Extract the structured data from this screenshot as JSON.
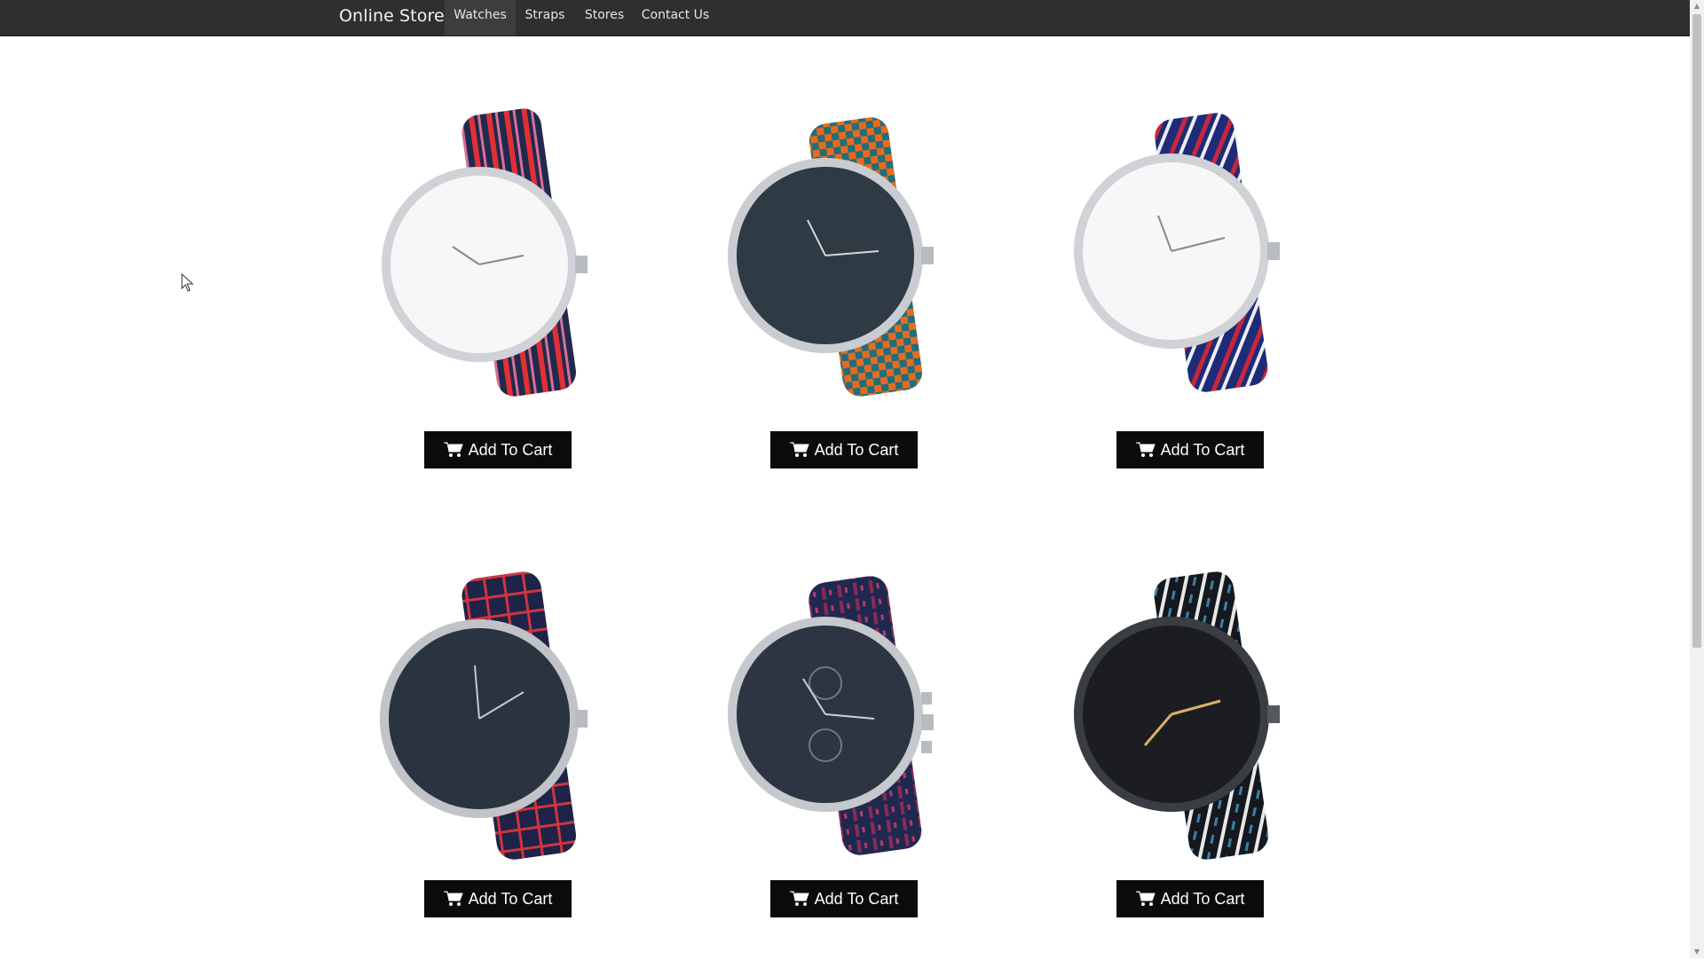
{
  "navbar": {
    "brand": "Online Store",
    "items": [
      {
        "label": "Watches",
        "active": true
      },
      {
        "label": "Straps",
        "active": false
      },
      {
        "label": "Stores",
        "active": false
      },
      {
        "label": "Contact Us",
        "active": false
      }
    ]
  },
  "products": [
    {
      "button_label": "Add To Cart",
      "icon": "cart-icon",
      "strap": "red-navy stripes",
      "dial": "white"
    },
    {
      "button_label": "Add To Cart",
      "icon": "cart-icon",
      "strap": "orange-teal houndstooth",
      "dial": "dark"
    },
    {
      "button_label": "Add To Cart",
      "icon": "cart-icon",
      "strap": "navy-red-white stripes",
      "dial": "white"
    },
    {
      "button_label": "Add To Cart",
      "icon": "cart-icon",
      "strap": "red-navy plaid",
      "dial": "dark"
    },
    {
      "button_label": "Add To Cart",
      "icon": "cart-icon",
      "strap": "navy-red pattern",
      "dial": "dark chronograph"
    },
    {
      "button_label": "Add To Cart",
      "icon": "cart-icon",
      "strap": "black-white pattern",
      "dial": "black gold"
    }
  ],
  "colors": {
    "navbar_bg": "#2f2f2f",
    "button_bg": "#0b0b0b",
    "page_bg": "#ffffff"
  }
}
